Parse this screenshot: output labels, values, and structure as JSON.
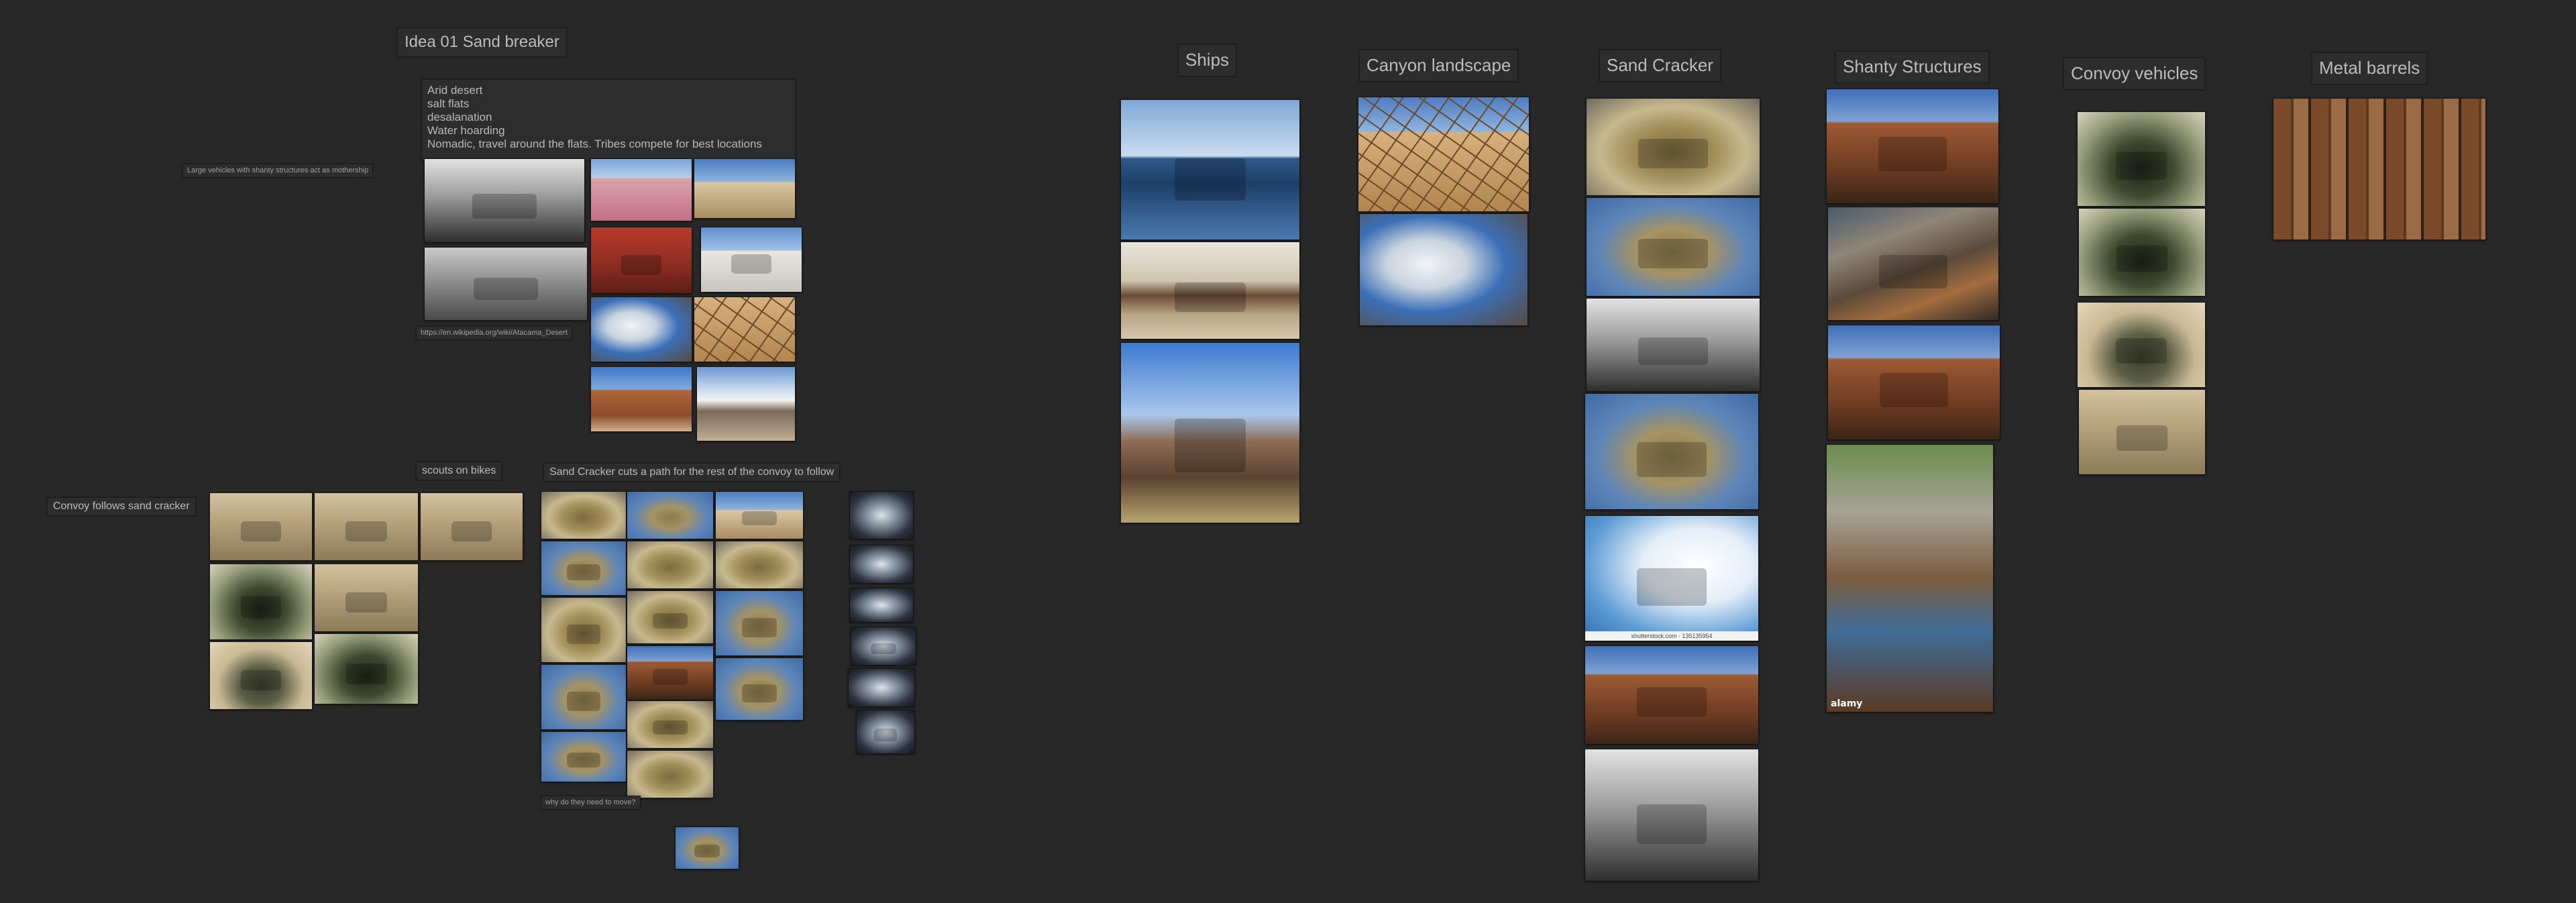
{
  "board": {
    "background": "#282828",
    "label_color": "#bcbcbc"
  },
  "titles": {
    "idea": "Idea 01 Sand breaker",
    "ships": "Ships",
    "canyon": "Canyon landscape",
    "sand_cracker": "Sand Cracker",
    "shanty": "Shanty Structures",
    "convoy_vehicles": "Convoy vehicles",
    "metal_barrels": "Metal barrels"
  },
  "notes": {
    "idea_lines": [
      "Arid desert",
      "salt flats",
      "desalanation",
      "Water hoarding",
      "Nomadic, travel around the flats. Tribes compete for best locations"
    ],
    "mothership": "Large vehicles with shanty structures act as mothership",
    "url": "https://en.wikipedia.org/wiki/Atacama_Desert",
    "scouts": "scouts on bikes",
    "convoy_follows": "Convoy follows sand cracker",
    "cracker_path": "Sand Cracker cuts a path for the rest of the convoy to follow",
    "why_move": "why do they need to move?"
  },
  "watermarks": {
    "shutterstock": "shutterstock.com · 135135954",
    "alamy": "alamy"
  }
}
